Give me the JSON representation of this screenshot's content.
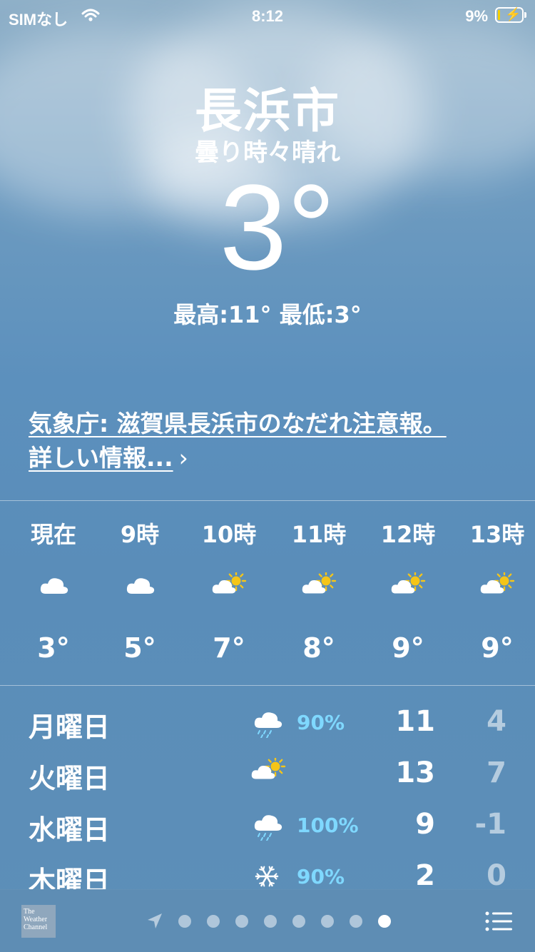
{
  "status_bar": {
    "carrier": "SIMなし",
    "time": "8:12",
    "battery": "9%",
    "battery_level": 0.09
  },
  "current": {
    "city": "長浜市",
    "condition": "曇り時々晴れ",
    "temperature": "3°",
    "hi_lo": "最高:11° 最低:3°"
  },
  "alert": {
    "line1": "気象庁: 滋賀県長浜市のなだれ注意報。",
    "line2": "詳しい情報...",
    "chevron": "›"
  },
  "hourly": [
    {
      "time": "現在",
      "icon": "cloud-icon",
      "temp": "3°"
    },
    {
      "time": "9時",
      "icon": "cloud-icon",
      "temp": "5°"
    },
    {
      "time": "10時",
      "icon": "partly-sunny-icon",
      "temp": "7°"
    },
    {
      "time": "11時",
      "icon": "partly-sunny-icon",
      "temp": "8°"
    },
    {
      "time": "12時",
      "icon": "partly-sunny-icon",
      "temp": "9°"
    },
    {
      "time": "13時",
      "icon": "partly-sunny-icon",
      "temp": "9°"
    }
  ],
  "daily": [
    {
      "day": "月曜日",
      "icon": "rain-icon",
      "prob": "90%",
      "hi": "11",
      "lo": "4"
    },
    {
      "day": "火曜日",
      "icon": "partly-sunny-icon",
      "prob": "",
      "hi": "13",
      "lo": "7"
    },
    {
      "day": "水曜日",
      "icon": "rain-icon",
      "prob": "100%",
      "hi": "9",
      "lo": "-1"
    },
    {
      "day": "木曜日",
      "icon": "snowflake-icon",
      "prob": "90%",
      "hi": "2",
      "lo": "0"
    }
  ],
  "bottom": {
    "logo_text": "The Weather Channel",
    "page_count": 8,
    "active_page": 8
  },
  "colors": {
    "precip": "#7fd8ff",
    "sun": "#f5c518"
  }
}
